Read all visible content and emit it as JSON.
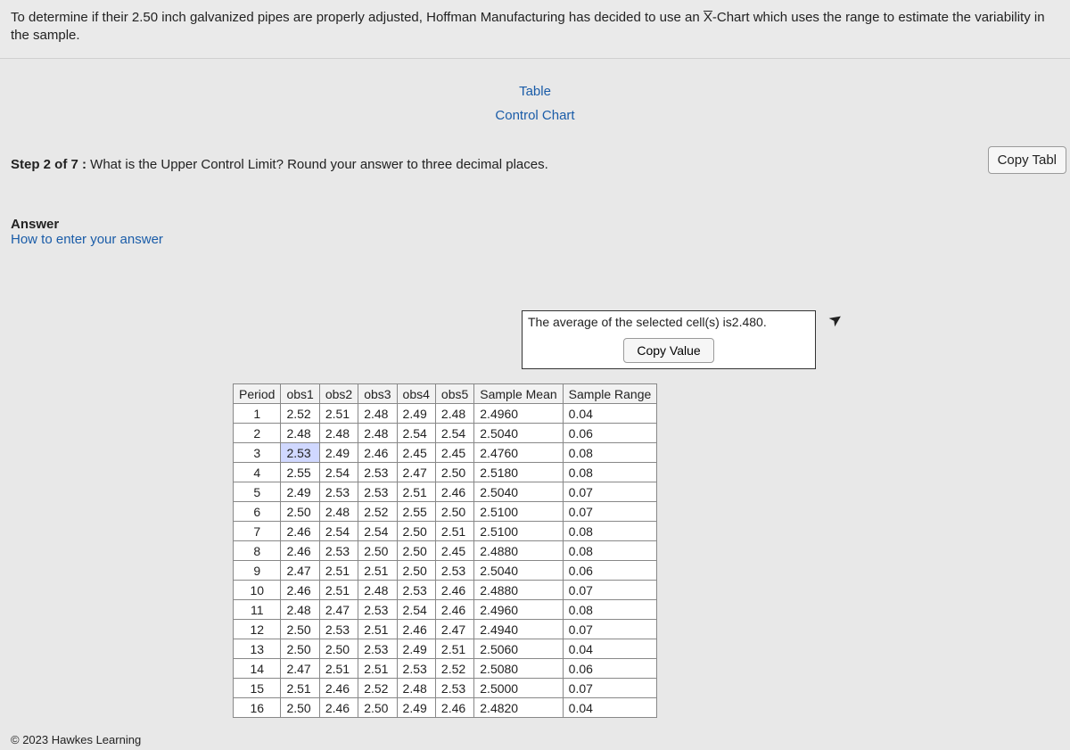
{
  "problem": "To determine if their 2.50 inch galvanized pipes are properly adjusted, Hoffman Manufacturing has decided to use an X̄-Chart which uses the range to estimate the variability in the sample.",
  "links": {
    "table": "Table",
    "control_chart": "Control Chart"
  },
  "copy_table": "Copy Tabl",
  "step": {
    "prefix": "Step 2 of 7 :",
    "text": " What is the Upper Control Limit? Round your answer to three decimal places."
  },
  "answer": {
    "label": "Answer",
    "howto": "How to enter your answer"
  },
  "avg": {
    "prefix": "The average of the selected cell(s) is",
    "value": "2.480",
    "copy": "Copy Value"
  },
  "headers": [
    "Period",
    "obs1",
    "obs2",
    "obs3",
    "obs4",
    "obs5",
    "Sample Mean",
    "Sample Range"
  ],
  "rows": [
    {
      "p": "1",
      "o": [
        "2.52",
        "2.51",
        "2.48",
        "2.49",
        "2.48"
      ],
      "m": "2.4960",
      "r": "0.04"
    },
    {
      "p": "2",
      "o": [
        "2.48",
        "2.48",
        "2.48",
        "2.54",
        "2.54"
      ],
      "m": "2.5040",
      "r": "0.06"
    },
    {
      "p": "3",
      "o": [
        "2.53",
        "2.49",
        "2.46",
        "2.45",
        "2.45"
      ],
      "m": "2.4760",
      "r": "0.08"
    },
    {
      "p": "4",
      "o": [
        "2.55",
        "2.54",
        "2.53",
        "2.47",
        "2.50"
      ],
      "m": "2.5180",
      "r": "0.08"
    },
    {
      "p": "5",
      "o": [
        "2.49",
        "2.53",
        "2.53",
        "2.51",
        "2.46"
      ],
      "m": "2.5040",
      "r": "0.07"
    },
    {
      "p": "6",
      "o": [
        "2.50",
        "2.48",
        "2.52",
        "2.55",
        "2.50"
      ],
      "m": "2.5100",
      "r": "0.07"
    },
    {
      "p": "7",
      "o": [
        "2.46",
        "2.54",
        "2.54",
        "2.50",
        "2.51"
      ],
      "m": "2.5100",
      "r": "0.08"
    },
    {
      "p": "8",
      "o": [
        "2.46",
        "2.53",
        "2.50",
        "2.50",
        "2.45"
      ],
      "m": "2.4880",
      "r": "0.08"
    },
    {
      "p": "9",
      "o": [
        "2.47",
        "2.51",
        "2.51",
        "2.50",
        "2.53"
      ],
      "m": "2.5040",
      "r": "0.06"
    },
    {
      "p": "10",
      "o": [
        "2.46",
        "2.51",
        "2.48",
        "2.53",
        "2.46"
      ],
      "m": "2.4880",
      "r": "0.07"
    },
    {
      "p": "11",
      "o": [
        "2.48",
        "2.47",
        "2.53",
        "2.54",
        "2.46"
      ],
      "m": "2.4960",
      "r": "0.08"
    },
    {
      "p": "12",
      "o": [
        "2.50",
        "2.53",
        "2.51",
        "2.46",
        "2.47"
      ],
      "m": "2.4940",
      "r": "0.07"
    },
    {
      "p": "13",
      "o": [
        "2.50",
        "2.50",
        "2.53",
        "2.49",
        "2.51"
      ],
      "m": "2.5060",
      "r": "0.04"
    },
    {
      "p": "14",
      "o": [
        "2.47",
        "2.51",
        "2.51",
        "2.53",
        "2.52"
      ],
      "m": "2.5080",
      "r": "0.06"
    },
    {
      "p": "15",
      "o": [
        "2.51",
        "2.46",
        "2.52",
        "2.48",
        "2.53"
      ],
      "m": "2.5000",
      "r": "0.07"
    },
    {
      "p": "16",
      "o": [
        "2.50",
        "2.46",
        "2.50",
        "2.49",
        "2.46"
      ],
      "m": "2.4820",
      "r": "0.04"
    }
  ],
  "selected_cell": {
    "row": 3,
    "col": 1
  },
  "footer": "© 2023 Hawkes Learning",
  "chart_data": {
    "type": "table",
    "title": "X-bar Chart sample data for 2.50 inch galvanized pipes",
    "columns": [
      "Period",
      "obs1",
      "obs2",
      "obs3",
      "obs4",
      "obs5",
      "Sample Mean",
      "Sample Range"
    ],
    "data": [
      [
        1,
        2.52,
        2.51,
        2.48,
        2.49,
        2.48,
        2.496,
        0.04
      ],
      [
        2,
        2.48,
        2.48,
        2.48,
        2.54,
        2.54,
        2.504,
        0.06
      ],
      [
        3,
        2.53,
        2.49,
        2.46,
        2.45,
        2.45,
        2.476,
        0.08
      ],
      [
        4,
        2.55,
        2.54,
        2.53,
        2.47,
        2.5,
        2.518,
        0.08
      ],
      [
        5,
        2.49,
        2.53,
        2.53,
        2.51,
        2.46,
        2.504,
        0.07
      ],
      [
        6,
        2.5,
        2.48,
        2.52,
        2.55,
        2.5,
        2.51,
        0.07
      ],
      [
        7,
        2.46,
        2.54,
        2.54,
        2.5,
        2.51,
        2.51,
        0.08
      ],
      [
        8,
        2.46,
        2.53,
        2.5,
        2.5,
        2.45,
        2.488,
        0.08
      ],
      [
        9,
        2.47,
        2.51,
        2.51,
        2.5,
        2.53,
        2.504,
        0.06
      ],
      [
        10,
        2.46,
        2.51,
        2.48,
        2.53,
        2.46,
        2.488,
        0.07
      ],
      [
        11,
        2.48,
        2.47,
        2.53,
        2.54,
        2.46,
        2.496,
        0.08
      ],
      [
        12,
        2.5,
        2.53,
        2.51,
        2.46,
        2.47,
        2.494,
        0.07
      ],
      [
        13,
        2.5,
        2.5,
        2.53,
        2.49,
        2.51,
        2.506,
        0.04
      ],
      [
        14,
        2.47,
        2.51,
        2.51,
        2.53,
        2.52,
        2.508,
        0.06
      ],
      [
        15,
        2.51,
        2.46,
        2.52,
        2.48,
        2.53,
        2.5,
        0.07
      ],
      [
        16,
        2.5,
        2.46,
        2.5,
        2.49,
        2.46,
        2.482,
        0.04
      ]
    ]
  }
}
